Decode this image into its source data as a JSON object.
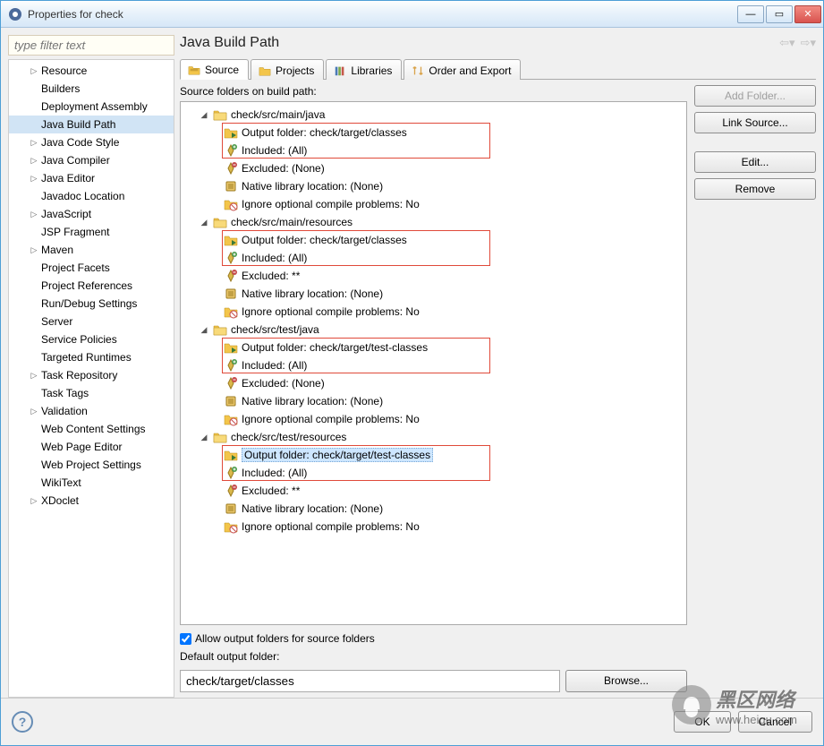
{
  "window": {
    "title": "Properties for check"
  },
  "filter_placeholder": "type filter text",
  "sidebar": {
    "items": [
      {
        "label": "Resource",
        "expandable": true
      },
      {
        "label": "Builders"
      },
      {
        "label": "Deployment Assembly"
      },
      {
        "label": "Java Build Path",
        "selected": true
      },
      {
        "label": "Java Code Style",
        "expandable": true
      },
      {
        "label": "Java Compiler",
        "expandable": true
      },
      {
        "label": "Java Editor",
        "expandable": true
      },
      {
        "label": "Javadoc Location"
      },
      {
        "label": "JavaScript",
        "expandable": true
      },
      {
        "label": "JSP Fragment"
      },
      {
        "label": "Maven",
        "expandable": true
      },
      {
        "label": "Project Facets"
      },
      {
        "label": "Project References"
      },
      {
        "label": "Run/Debug Settings"
      },
      {
        "label": "Server"
      },
      {
        "label": "Service Policies"
      },
      {
        "label": "Targeted Runtimes"
      },
      {
        "label": "Task Repository",
        "expandable": true
      },
      {
        "label": "Task Tags"
      },
      {
        "label": "Validation",
        "expandable": true
      },
      {
        "label": "Web Content Settings"
      },
      {
        "label": "Web Page Editor"
      },
      {
        "label": "Web Project Settings"
      },
      {
        "label": "WikiText"
      },
      {
        "label": "XDoclet",
        "expandable": true
      }
    ]
  },
  "page_title": "Java Build Path",
  "tabs": [
    {
      "label": "Source",
      "active": true,
      "icon": "source"
    },
    {
      "label": "Projects",
      "icon": "projects"
    },
    {
      "label": "Libraries",
      "icon": "libraries"
    },
    {
      "label": "Order and Export",
      "icon": "order"
    }
  ],
  "source_label": "Source folders on build path:",
  "source_folders": [
    {
      "path": "check/src/main/java",
      "children": [
        {
          "label": "Output folder: check/target/classes",
          "icon": "out",
          "hl_start": true
        },
        {
          "label": "Included: (All)",
          "icon": "inc",
          "hl_end": true
        },
        {
          "label": "Excluded: (None)",
          "icon": "exc"
        },
        {
          "label": "Native library location: (None)",
          "icon": "lib"
        },
        {
          "label": "Ignore optional compile problems: No",
          "icon": "ign"
        }
      ]
    },
    {
      "path": "check/src/main/resources",
      "children": [
        {
          "label": "Output folder: check/target/classes",
          "icon": "out",
          "hl_start": true
        },
        {
          "label": "Included: (All)",
          "icon": "inc",
          "hl_end": true
        },
        {
          "label": "Excluded: **",
          "icon": "exc"
        },
        {
          "label": "Native library location: (None)",
          "icon": "lib"
        },
        {
          "label": "Ignore optional compile problems: No",
          "icon": "ign"
        }
      ]
    },
    {
      "path": "check/src/test/java",
      "children": [
        {
          "label": "Output folder: check/target/test-classes",
          "icon": "out",
          "hl_start": true
        },
        {
          "label": "Included: (All)",
          "icon": "inc",
          "hl_end": true
        },
        {
          "label": "Excluded: (None)",
          "icon": "exc"
        },
        {
          "label": "Native library location: (None)",
          "icon": "lib"
        },
        {
          "label": "Ignore optional compile problems: No",
          "icon": "ign"
        }
      ]
    },
    {
      "path": "check/src/test/resources",
      "children": [
        {
          "label": "Output folder: check/target/test-classes",
          "icon": "out",
          "selected": true,
          "hl_start": true
        },
        {
          "label": "Included: (All)",
          "icon": "inc",
          "hl_end": true
        },
        {
          "label": "Excluded: **",
          "icon": "exc"
        },
        {
          "label": "Native library location: (None)",
          "icon": "lib"
        },
        {
          "label": "Ignore optional compile problems: No",
          "icon": "ign"
        }
      ]
    }
  ],
  "buttons": {
    "add_folder": "Add Folder...",
    "link_source": "Link Source...",
    "edit": "Edit...",
    "remove": "Remove"
  },
  "allow_output": "Allow output folders for source folders",
  "default_output_label": "Default output folder:",
  "default_output_value": "check/target/classes",
  "browse": "Browse...",
  "footer": {
    "ok": "OK",
    "cancel": "Cancel"
  },
  "watermark": {
    "big": "黑区网络",
    "url": "www.heiqu.com"
  }
}
